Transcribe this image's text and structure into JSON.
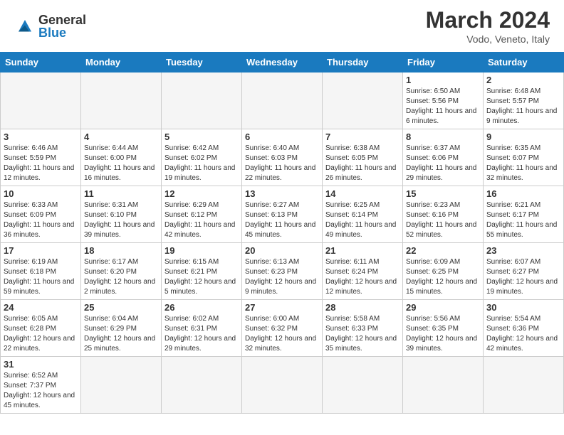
{
  "header": {
    "logo_general": "General",
    "logo_blue": "Blue",
    "month_year": "March 2024",
    "location": "Vodo, Veneto, Italy"
  },
  "weekdays": [
    "Sunday",
    "Monday",
    "Tuesday",
    "Wednesday",
    "Thursday",
    "Friday",
    "Saturday"
  ],
  "weeks": [
    [
      {
        "day": "",
        "info": ""
      },
      {
        "day": "",
        "info": ""
      },
      {
        "day": "",
        "info": ""
      },
      {
        "day": "",
        "info": ""
      },
      {
        "day": "",
        "info": ""
      },
      {
        "day": "1",
        "info": "Sunrise: 6:50 AM\nSunset: 5:56 PM\nDaylight: 11 hours and 6 minutes."
      },
      {
        "day": "2",
        "info": "Sunrise: 6:48 AM\nSunset: 5:57 PM\nDaylight: 11 hours and 9 minutes."
      }
    ],
    [
      {
        "day": "3",
        "info": "Sunrise: 6:46 AM\nSunset: 5:59 PM\nDaylight: 11 hours and 12 minutes."
      },
      {
        "day": "4",
        "info": "Sunrise: 6:44 AM\nSunset: 6:00 PM\nDaylight: 11 hours and 16 minutes."
      },
      {
        "day": "5",
        "info": "Sunrise: 6:42 AM\nSunset: 6:02 PM\nDaylight: 11 hours and 19 minutes."
      },
      {
        "day": "6",
        "info": "Sunrise: 6:40 AM\nSunset: 6:03 PM\nDaylight: 11 hours and 22 minutes."
      },
      {
        "day": "7",
        "info": "Sunrise: 6:38 AM\nSunset: 6:05 PM\nDaylight: 11 hours and 26 minutes."
      },
      {
        "day": "8",
        "info": "Sunrise: 6:37 AM\nSunset: 6:06 PM\nDaylight: 11 hours and 29 minutes."
      },
      {
        "day": "9",
        "info": "Sunrise: 6:35 AM\nSunset: 6:07 PM\nDaylight: 11 hours and 32 minutes."
      }
    ],
    [
      {
        "day": "10",
        "info": "Sunrise: 6:33 AM\nSunset: 6:09 PM\nDaylight: 11 hours and 36 minutes."
      },
      {
        "day": "11",
        "info": "Sunrise: 6:31 AM\nSunset: 6:10 PM\nDaylight: 11 hours and 39 minutes."
      },
      {
        "day": "12",
        "info": "Sunrise: 6:29 AM\nSunset: 6:12 PM\nDaylight: 11 hours and 42 minutes."
      },
      {
        "day": "13",
        "info": "Sunrise: 6:27 AM\nSunset: 6:13 PM\nDaylight: 11 hours and 45 minutes."
      },
      {
        "day": "14",
        "info": "Sunrise: 6:25 AM\nSunset: 6:14 PM\nDaylight: 11 hours and 49 minutes."
      },
      {
        "day": "15",
        "info": "Sunrise: 6:23 AM\nSunset: 6:16 PM\nDaylight: 11 hours and 52 minutes."
      },
      {
        "day": "16",
        "info": "Sunrise: 6:21 AM\nSunset: 6:17 PM\nDaylight: 11 hours and 55 minutes."
      }
    ],
    [
      {
        "day": "17",
        "info": "Sunrise: 6:19 AM\nSunset: 6:18 PM\nDaylight: 11 hours and 59 minutes."
      },
      {
        "day": "18",
        "info": "Sunrise: 6:17 AM\nSunset: 6:20 PM\nDaylight: 12 hours and 2 minutes."
      },
      {
        "day": "19",
        "info": "Sunrise: 6:15 AM\nSunset: 6:21 PM\nDaylight: 12 hours and 5 minutes."
      },
      {
        "day": "20",
        "info": "Sunrise: 6:13 AM\nSunset: 6:23 PM\nDaylight: 12 hours and 9 minutes."
      },
      {
        "day": "21",
        "info": "Sunrise: 6:11 AM\nSunset: 6:24 PM\nDaylight: 12 hours and 12 minutes."
      },
      {
        "day": "22",
        "info": "Sunrise: 6:09 AM\nSunset: 6:25 PM\nDaylight: 12 hours and 15 minutes."
      },
      {
        "day": "23",
        "info": "Sunrise: 6:07 AM\nSunset: 6:27 PM\nDaylight: 12 hours and 19 minutes."
      }
    ],
    [
      {
        "day": "24",
        "info": "Sunrise: 6:05 AM\nSunset: 6:28 PM\nDaylight: 12 hours and 22 minutes."
      },
      {
        "day": "25",
        "info": "Sunrise: 6:04 AM\nSunset: 6:29 PM\nDaylight: 12 hours and 25 minutes."
      },
      {
        "day": "26",
        "info": "Sunrise: 6:02 AM\nSunset: 6:31 PM\nDaylight: 12 hours and 29 minutes."
      },
      {
        "day": "27",
        "info": "Sunrise: 6:00 AM\nSunset: 6:32 PM\nDaylight: 12 hours and 32 minutes."
      },
      {
        "day": "28",
        "info": "Sunrise: 5:58 AM\nSunset: 6:33 PM\nDaylight: 12 hours and 35 minutes."
      },
      {
        "day": "29",
        "info": "Sunrise: 5:56 AM\nSunset: 6:35 PM\nDaylight: 12 hours and 39 minutes."
      },
      {
        "day": "30",
        "info": "Sunrise: 5:54 AM\nSunset: 6:36 PM\nDaylight: 12 hours and 42 minutes."
      }
    ],
    [
      {
        "day": "31",
        "info": "Sunrise: 6:52 AM\nSunset: 7:37 PM\nDaylight: 12 hours and 45 minutes."
      },
      {
        "day": "",
        "info": ""
      },
      {
        "day": "",
        "info": ""
      },
      {
        "day": "",
        "info": ""
      },
      {
        "day": "",
        "info": ""
      },
      {
        "day": "",
        "info": ""
      },
      {
        "day": "",
        "info": ""
      }
    ]
  ]
}
